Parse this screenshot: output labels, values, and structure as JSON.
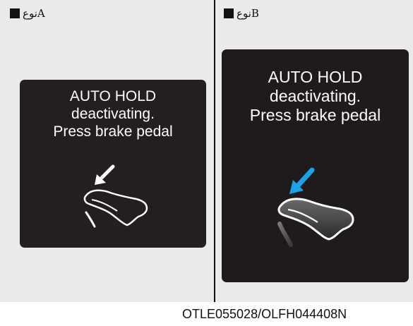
{
  "labels": {
    "type_a": "نوعA",
    "type_b": "نوعB"
  },
  "screen_a": {
    "line1": "AUTO HOLD",
    "line2": "deactivating.",
    "line3": "Press brake pedal",
    "arrow_color": "#ffffff"
  },
  "screen_b": {
    "line1": "AUTO HOLD",
    "line2": "deactivating.",
    "line3": "Press brake pedal",
    "arrow_color": "#1aa3e8"
  },
  "icons": {
    "bullet": "square-bullet-icon",
    "pedal": "brake-pedal-foot-icon",
    "arrow": "down-left-arrow-icon"
  },
  "colors": {
    "panel_bg": "#eaeaea",
    "screen_bg": "#231f20",
    "text": "#ffffff"
  },
  "footer": {
    "code": "OTLE055028/OLFH044408N"
  }
}
